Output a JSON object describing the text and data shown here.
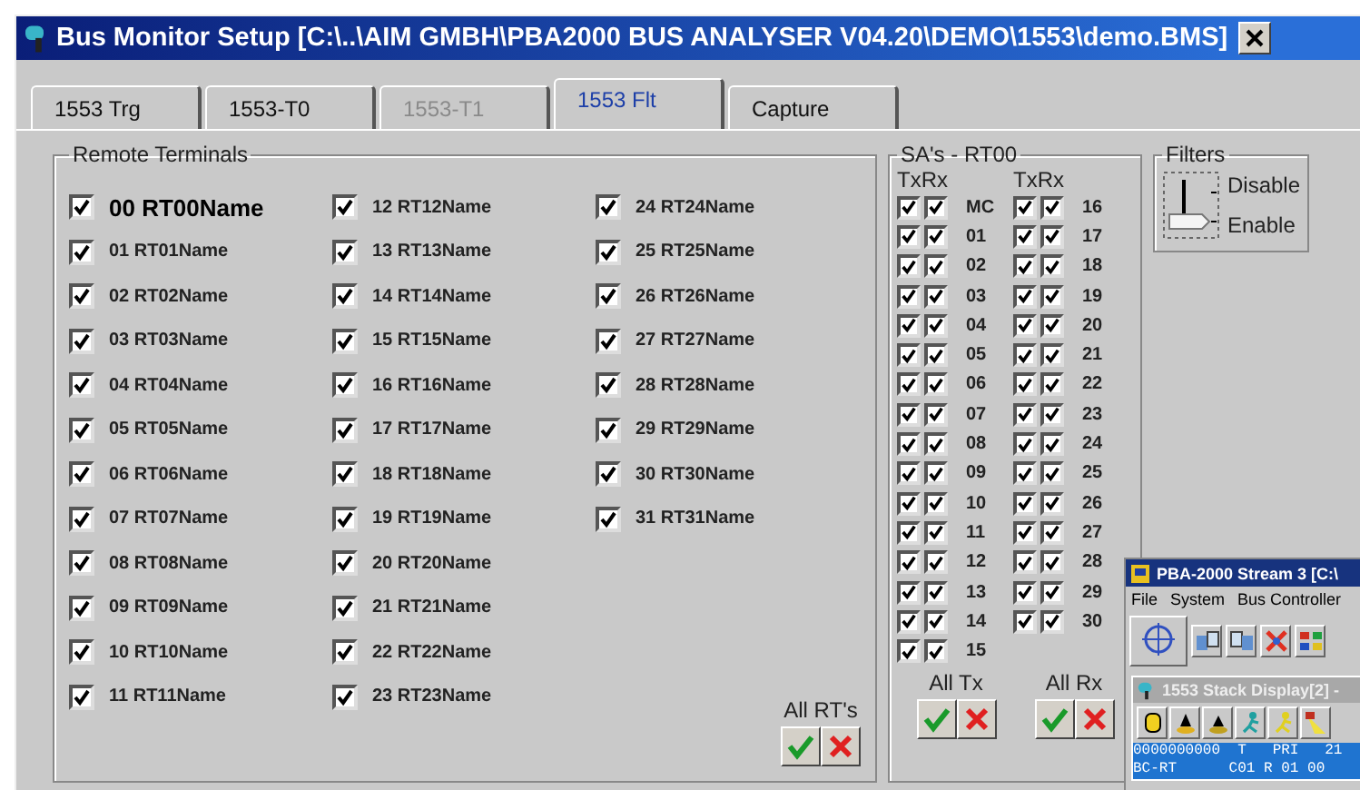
{
  "window": {
    "title": "Bus Monitor Setup [C:\\..\\AIM GMBH\\PBA2000 BUS ANALYSER V04.20\\DEMO\\1553\\demo.BMS]"
  },
  "tabs": [
    {
      "label": "1553 Trg",
      "selected": false,
      "disabled": false
    },
    {
      "label": "1553-T0",
      "selected": false,
      "disabled": false
    },
    {
      "label": "1553-T1",
      "selected": false,
      "disabled": true
    },
    {
      "label": "1553 Flt",
      "selected": true,
      "disabled": false
    },
    {
      "label": "Capture",
      "selected": false,
      "disabled": false
    }
  ],
  "remote_terminals": {
    "title": "Remote Terminals",
    "items": [
      {
        "label": "00 RT00Name",
        "checked": true,
        "selected": true
      },
      {
        "label": "01 RT01Name",
        "checked": true,
        "selected": false
      },
      {
        "label": "02 RT02Name",
        "checked": true,
        "selected": false
      },
      {
        "label": "03 RT03Name",
        "checked": true,
        "selected": false
      },
      {
        "label": "04 RT04Name",
        "checked": true,
        "selected": false
      },
      {
        "label": "05 RT05Name",
        "checked": true,
        "selected": false
      },
      {
        "label": "06 RT06Name",
        "checked": true,
        "selected": false
      },
      {
        "label": "07 RT07Name",
        "checked": true,
        "selected": false
      },
      {
        "label": "08 RT08Name",
        "checked": true,
        "selected": false
      },
      {
        "label": "09 RT09Name",
        "checked": true,
        "selected": false
      },
      {
        "label": "10 RT10Name",
        "checked": true,
        "selected": false
      },
      {
        "label": "11 RT11Name",
        "checked": true,
        "selected": false
      },
      {
        "label": "12 RT12Name",
        "checked": true,
        "selected": false
      },
      {
        "label": "13 RT13Name",
        "checked": true,
        "selected": false
      },
      {
        "label": "14 RT14Name",
        "checked": true,
        "selected": false
      },
      {
        "label": "15 RT15Name",
        "checked": true,
        "selected": false
      },
      {
        "label": "16 RT16Name",
        "checked": true,
        "selected": false
      },
      {
        "label": "17 RT17Name",
        "checked": true,
        "selected": false
      },
      {
        "label": "18 RT18Name",
        "checked": true,
        "selected": false
      },
      {
        "label": "19 RT19Name",
        "checked": true,
        "selected": false
      },
      {
        "label": "20 RT20Name",
        "checked": true,
        "selected": false
      },
      {
        "label": "21 RT21Name",
        "checked": true,
        "selected": false
      },
      {
        "label": "22 RT22Name",
        "checked": true,
        "selected": false
      },
      {
        "label": "23 RT23Name",
        "checked": true,
        "selected": false
      },
      {
        "label": "24 RT24Name",
        "checked": true,
        "selected": false
      },
      {
        "label": "25 RT25Name",
        "checked": true,
        "selected": false
      },
      {
        "label": "26 RT26Name",
        "checked": true,
        "selected": false
      },
      {
        "label": "27 RT27Name",
        "checked": true,
        "selected": false
      },
      {
        "label": "28 RT28Name",
        "checked": true,
        "selected": false
      },
      {
        "label": "29 RT29Name",
        "checked": true,
        "selected": false
      },
      {
        "label": "30 RT30Name",
        "checked": true,
        "selected": false
      },
      {
        "label": "31 RT31Name",
        "checked": true,
        "selected": false
      }
    ],
    "all_label": "All RT's"
  },
  "subaddresses": {
    "title": "SA's - RT00",
    "columns": [
      {
        "header_tx": "Tx",
        "header_rx": "Rx",
        "rows": [
          {
            "label": "MC",
            "tx": true,
            "rx": true
          },
          {
            "label": "01",
            "tx": true,
            "rx": true
          },
          {
            "label": "02",
            "tx": true,
            "rx": true
          },
          {
            "label": "03",
            "tx": true,
            "rx": true
          },
          {
            "label": "04",
            "tx": true,
            "rx": true
          },
          {
            "label": "05",
            "tx": true,
            "rx": true
          },
          {
            "label": "06",
            "tx": true,
            "rx": true
          },
          {
            "label": "07",
            "tx": true,
            "rx": true
          },
          {
            "label": "08",
            "tx": true,
            "rx": true
          },
          {
            "label": "09",
            "tx": true,
            "rx": true
          },
          {
            "label": "10",
            "tx": true,
            "rx": true
          },
          {
            "label": "11",
            "tx": true,
            "rx": true
          },
          {
            "label": "12",
            "tx": true,
            "rx": true
          },
          {
            "label": "13",
            "tx": true,
            "rx": true
          },
          {
            "label": "14",
            "tx": true,
            "rx": true
          },
          {
            "label": "15",
            "tx": true,
            "rx": true
          }
        ]
      },
      {
        "header_tx": "Tx",
        "header_rx": "Rx",
        "rows": [
          {
            "label": "16",
            "tx": true,
            "rx": true
          },
          {
            "label": "17",
            "tx": true,
            "rx": true
          },
          {
            "label": "18",
            "tx": true,
            "rx": true
          },
          {
            "label": "19",
            "tx": true,
            "rx": true
          },
          {
            "label": "20",
            "tx": true,
            "rx": true
          },
          {
            "label": "21",
            "tx": true,
            "rx": true
          },
          {
            "label": "22",
            "tx": true,
            "rx": true
          },
          {
            "label": "23",
            "tx": true,
            "rx": true
          },
          {
            "label": "24",
            "tx": true,
            "rx": true
          },
          {
            "label": "25",
            "tx": true,
            "rx": true
          },
          {
            "label": "26",
            "tx": true,
            "rx": true
          },
          {
            "label": "27",
            "tx": true,
            "rx": true
          },
          {
            "label": "28",
            "tx": true,
            "rx": true
          },
          {
            "label": "29",
            "tx": true,
            "rx": true
          },
          {
            "label": "30",
            "tx": true,
            "rx": true
          }
        ]
      }
    ],
    "all_tx_label": "All Tx",
    "all_rx_label": "All Rx"
  },
  "filters": {
    "title": "Filters",
    "off_label": "Disable",
    "on_label": "Enable",
    "on": true
  },
  "background_window": {
    "title": "PBA-2000 Stream 3  [C:\\",
    "menu": [
      "File",
      "System",
      "Bus Controller"
    ],
    "child_window": {
      "title": "1553 Stack Display[2] -",
      "rows": [
        "0000000000  T   PRI   21",
        "BC-RT      C01 R 01 00"
      ]
    }
  }
}
